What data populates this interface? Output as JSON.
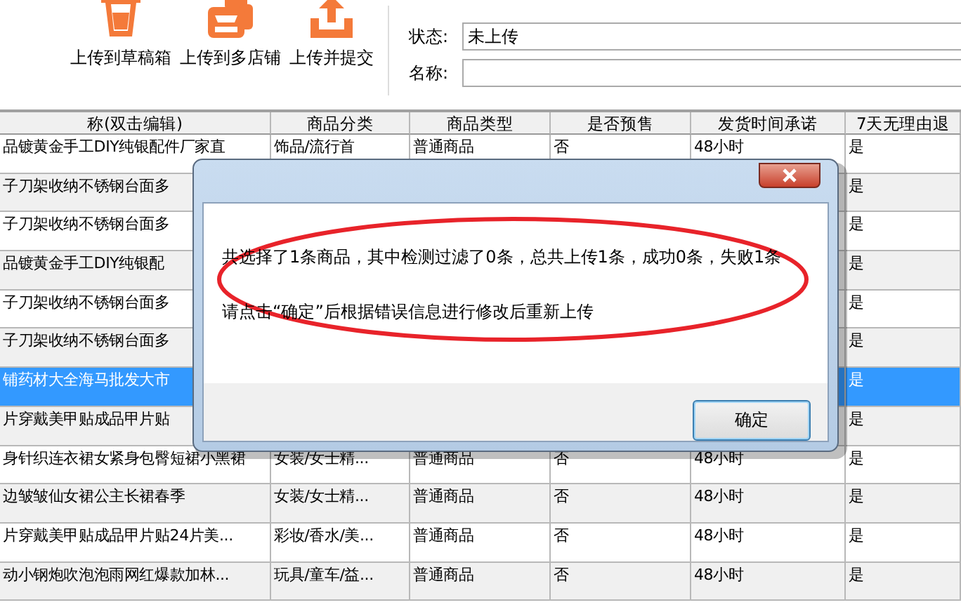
{
  "toolbar": {
    "buttons": [
      {
        "label": "上传到草稿箱",
        "kind": "drafts"
      },
      {
        "label": "上传到多店铺",
        "kind": "stores"
      },
      {
        "label": "上传并提交",
        "kind": "submit"
      }
    ],
    "fields": [
      {
        "label": "状态:",
        "value": "未上传"
      },
      {
        "label": "名称:"
      }
    ]
  },
  "table": {
    "columns": [
      "称(双击编辑)",
      "商品分类",
      "商品类型",
      "是否预售",
      "发货时间承诺",
      "7天无理由退"
    ],
    "rows": [
      {
        "selected": false,
        "name": "品镀黄金手工DIY纯银配件厂家直",
        "category": "饰品/流行首",
        "type": "普通商品",
        "presale": "否",
        "shipping": "48小时",
        "returns": "是"
      },
      {
        "selected": false,
        "name": "子刀架收纳不锈钢台面多",
        "returns": "是"
      },
      {
        "selected": false,
        "name": "子刀架收纳不锈钢台面多",
        "returns": "是"
      },
      {
        "selected": false,
        "name": "品镀黄金手工DIY纯银配",
        "returns": "是"
      },
      {
        "selected": false,
        "name": "子刀架收纳不锈钢台面多",
        "returns": "是"
      },
      {
        "selected": false,
        "name": "子刀架收纳不锈钢台面多",
        "returns": "是"
      },
      {
        "selected": true,
        "name": "铺药材大全海马批发大市",
        "returns": "是"
      },
      {
        "selected": false,
        "name": "片穿戴美甲贴成品甲片贴",
        "returns": "是"
      },
      {
        "selected": false,
        "name": "身针织连衣裙女紧身包臀短裙小黑裙",
        "category": "女装/女士精...",
        "type": "普通商品",
        "presale": "否",
        "shipping": "48小时",
        "returns": "是"
      },
      {
        "selected": false,
        "name": "边皱皱仙女裙公主长裙春季",
        "category": "女装/女士精...",
        "type": "普通商品",
        "presale": "否",
        "shipping": "48小时",
        "returns": "是"
      },
      {
        "selected": false,
        "name": "片穿戴美甲贴成品甲片贴24片美...",
        "category": "彩妆/香水/美...",
        "type": "普通商品",
        "presale": "否",
        "shipping": "48小时",
        "returns": "是"
      },
      {
        "selected": false,
        "name": "动小钢炮吹泡泡雨网红爆款加林...",
        "category": "玩具/童车/益...",
        "type": "普通商品",
        "presale": "否",
        "shipping": "48小时",
        "returns": "是"
      }
    ]
  },
  "dialog": {
    "message_lines": [
      "共选择了1条商品，其中检测过滤了0条，总共上传1条，成功0条，失败1条",
      "请点击“确定”后根据错误信息进行修改后重新上传"
    ],
    "buttons": [
      "确定"
    ]
  }
}
